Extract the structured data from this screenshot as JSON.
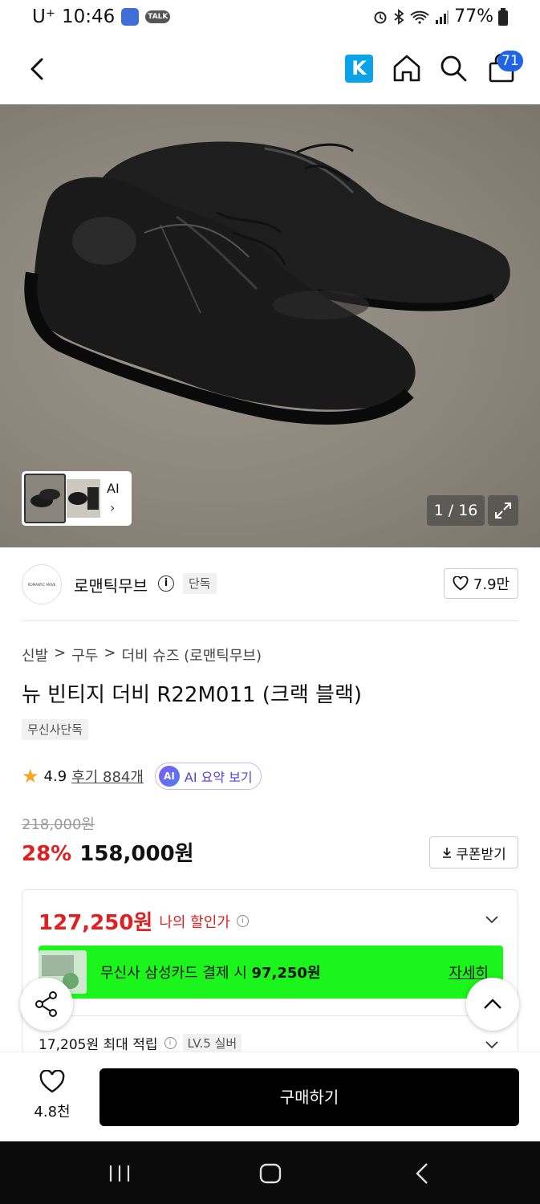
{
  "status_bar": {
    "carrier": "U⁺",
    "time": "10:46",
    "talk_label": "TALK",
    "battery": "77%"
  },
  "header": {
    "k_logo": "K",
    "cart_count": "71"
  },
  "gallery": {
    "thumb_label": "AI",
    "counter": "1 / 16"
  },
  "brand": {
    "logo_text": "ROMANTIC MOVE",
    "name": "로맨틱무브",
    "exclusive_tag": "단독",
    "likes": "7.9만"
  },
  "breadcrumb": [
    "신발",
    "구두",
    "더비 슈즈 (로맨틱무브)"
  ],
  "breadcrumb_sep": ">",
  "product": {
    "title": "뉴 빈티지 더비 R22M011 (크랙 블랙)",
    "tag": "무신사단독",
    "rating": "4.9",
    "reviews": "후기 884개",
    "ai_badge": "AI",
    "ai_summary": "AI 요약 보기",
    "original_price": "218,000원",
    "discount_rate": "28%",
    "sale_price": "158,000원",
    "coupon_label": "쿠폰받기"
  },
  "discount_card": {
    "my_price": "127,250원",
    "my_price_label": "나의 할인가",
    "promo_text": "무신사 삼성카드 결제 시",
    "promo_price": "97,250원",
    "promo_link": "자세히",
    "points": "17,205원 최대 적립",
    "level": "LV.5 실버"
  },
  "bottom_bar": {
    "wish_count": "4.8천",
    "buy_label": "구매하기"
  },
  "colors": {
    "accent_red": "#e02020",
    "promo_green": "#1bf51b",
    "cart_badge_blue": "#1f63e6",
    "star": "#f5a623"
  }
}
